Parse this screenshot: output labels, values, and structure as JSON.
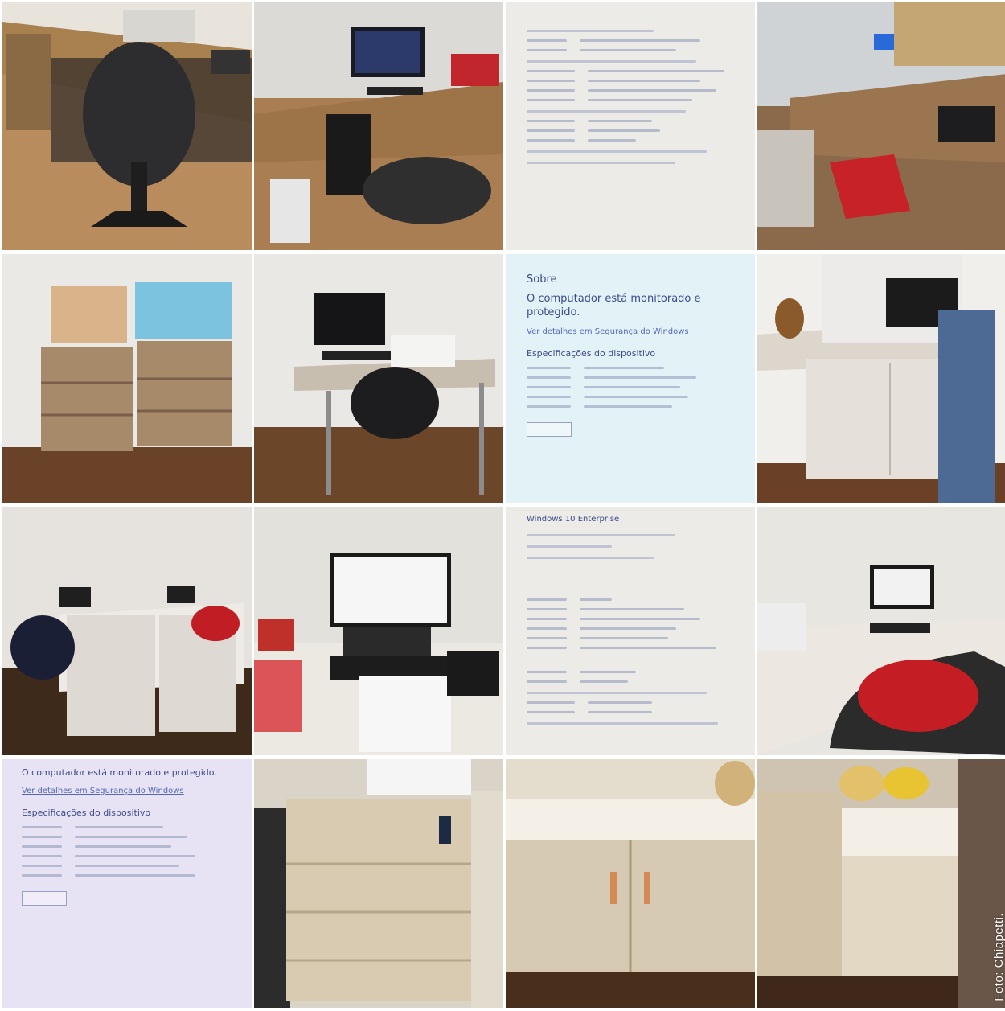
{
  "screens": {
    "about_title": "Sobre",
    "about_subtitle": "O computador está monitorado e protegido.",
    "security_link": "Ver detalhes em Segurança do Windows",
    "device_specs": "Especificações do dispositivo",
    "windows_edition": "Windows 10 Enterprise"
  },
  "photo_caption": "Foto: Chiapetti."
}
